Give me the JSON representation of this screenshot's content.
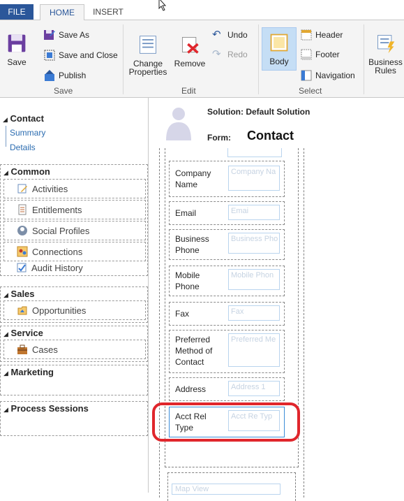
{
  "tabs": {
    "file": "FILE",
    "home": "HOME",
    "insert": "INSERT"
  },
  "ribbon": {
    "save": "Save",
    "save_as": "Save As",
    "save_and_close": "Save and Close",
    "publish": "Publish",
    "save_group": "Save",
    "change_properties_line1": "Change",
    "change_properties_line2": "Properties",
    "remove": "Remove",
    "undo": "Undo",
    "redo": "Redo",
    "edit_group": "Edit",
    "body": "Body",
    "header": "Header",
    "footer": "Footer",
    "navigation": "Navigation",
    "select_group": "Select",
    "business_rules_line1": "Business",
    "business_rules_line2": "Rules"
  },
  "nav": {
    "contact": "Contact",
    "summary": "Summary",
    "details": "Details",
    "sections": [
      {
        "title": "Common",
        "items": [
          "Activities",
          "Entitlements",
          "Social Profiles",
          "Connections",
          "Audit History"
        ]
      },
      {
        "title": "Sales",
        "items": [
          "Opportunities"
        ]
      },
      {
        "title": "Service",
        "items": [
          "Cases"
        ]
      },
      {
        "title": "Marketing",
        "items": []
      },
      {
        "title": "Process Sessions",
        "items": []
      }
    ]
  },
  "form": {
    "solution": "Solution: Default Solution",
    "form_label": "Form:",
    "form_name": "Contact",
    "fields": [
      {
        "label": "Company Name",
        "placeholder": "Company Na"
      },
      {
        "label": "Email",
        "placeholder": "Emai"
      },
      {
        "label": "Business Phone",
        "placeholder": "Business Pho"
      },
      {
        "label": "Mobile Phone",
        "placeholder": "Mobile Phon"
      },
      {
        "label": "Fax",
        "placeholder": "Fax"
      },
      {
        "label": "Preferred Method of Contact",
        "placeholder": "Preferred Me"
      },
      {
        "label": "Address",
        "placeholder": "Address 1"
      },
      {
        "label": "Acct Rel Type",
        "placeholder": "Acct Re  Typ"
      }
    ],
    "map_view": "Map View"
  },
  "colors": {
    "accent": "#2b579a",
    "highlight": "#e0262c",
    "link": "#2b6cb0"
  }
}
